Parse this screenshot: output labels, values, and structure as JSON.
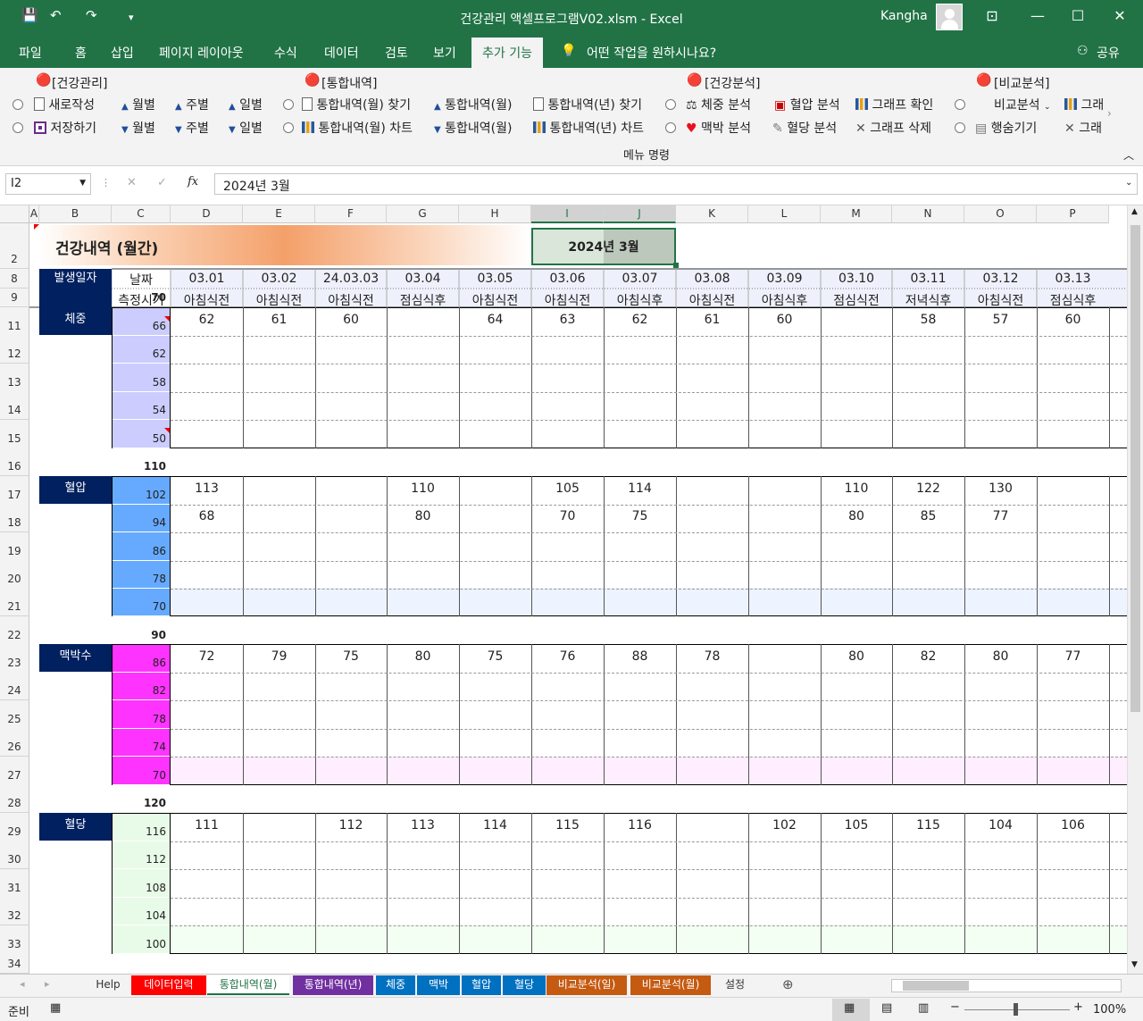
{
  "titlebar": {
    "title": "건강관리 액셀프로그램V02.xlsm  -  Excel",
    "user": "Kangha"
  },
  "menu": {
    "tabs": [
      "파일",
      "홈",
      "삽입",
      "페이지 레이아웃",
      "수식",
      "데이터",
      "검토",
      "보기",
      "추가 기능"
    ],
    "active_tab": "추가 기능",
    "search": "어떤 작업을 원하시나요?",
    "share": "공유"
  },
  "ribbon": {
    "groups": [
      "[건강관리]",
      "[통합내역]",
      "[건강분석]",
      "[비교분석]"
    ],
    "new": "새로작성",
    "save": "저장하기",
    "month": "월별",
    "week": "주별",
    "day": "일별",
    "find_month": "통합내역(월) 찾기",
    "chart_month": "통합내역(월) 차트",
    "integ_month": "통합내역(월)",
    "find_year": "통합내역(년) 찾기",
    "chart_year": "통합내역(년) 차트",
    "weight_analysis": "체중 분석",
    "pulse_analysis": "맥박 분석",
    "bp_analysis": "혈압 분석",
    "sugar_analysis": "혈당 분석",
    "graph_check": "그래프 확인",
    "graph_delete": "그래프 삭제",
    "compare": "비교분석",
    "hide_rows": "행숨기기",
    "graph_cut": "그래",
    "delete_cut": "그래",
    "group_label": "메뉴 명령"
  },
  "formula_bar": {
    "name_box": "I2",
    "formula": "2024년 3월"
  },
  "columns": [
    "A",
    "B",
    "C",
    "D",
    "E",
    "F",
    "G",
    "H",
    "I",
    "J",
    "K",
    "L",
    "M",
    "N",
    "O",
    "P"
  ],
  "rows": [
    "2",
    "8",
    "9",
    "11",
    "12",
    "13",
    "14",
    "15",
    "16",
    "17",
    "18",
    "19",
    "20",
    "21",
    "22",
    "23",
    "24",
    "25",
    "26",
    "27",
    "28",
    "29",
    "30",
    "31",
    "32",
    "33",
    "34"
  ],
  "sheet": {
    "title": "건강내역 (월간)",
    "month": "2024년 3월",
    "row_date_label": "발생일자",
    "date_label": "날짜",
    "time_label": "측정시기",
    "dates": [
      "03.01",
      "03.02",
      "24.03.03",
      "03.04",
      "03.05",
      "03.06",
      "03.07",
      "03.08",
      "03.09",
      "03.10",
      "03.11",
      "03.12",
      "03.13"
    ],
    "times": [
      "아침식전",
      "아침식전",
      "아침식전",
      "점심식후",
      "아침식전",
      "아침식전",
      "아침식후",
      "아침식전",
      "아침식후",
      "점심식전",
      "저녁식후",
      "아침식전",
      "점심식후"
    ],
    "sections": [
      {
        "label": "체중",
        "color": "#ccccff",
        "top": "70",
        "ticks": [
          "66",
          "62",
          "58",
          "54",
          "50"
        ],
        "values": [
          [
            "62",
            "61",
            "60",
            "",
            "64",
            "63",
            "62",
            "61",
            "60",
            "",
            "58",
            "57",
            "60"
          ]
        ]
      },
      {
        "label": "혈압",
        "color": "#66aaff",
        "top": "110",
        "ticks": [
          "102",
          "94",
          "86",
          "78",
          "70"
        ],
        "values": [
          [
            "113",
            "",
            "",
            "110",
            "",
            "105",
            "114",
            "",
            "",
            "110",
            "122",
            "130",
            ""
          ],
          [
            "68",
            "",
            "",
            "80",
            "",
            "70",
            "75",
            "",
            "",
            "80",
            "85",
            "77",
            ""
          ]
        ]
      },
      {
        "label": "맥박수",
        "color": "#ff33ff",
        "top": "90",
        "ticks": [
          "86",
          "82",
          "78",
          "74",
          "70"
        ],
        "values": [
          [
            "72",
            "79",
            "75",
            "80",
            "75",
            "76",
            "88",
            "78",
            "",
            "80",
            "82",
            "80",
            "77"
          ]
        ]
      },
      {
        "label": "혈당",
        "color": "#e8fbe8",
        "top": "120",
        "ticks": [
          "116",
          "112",
          "108",
          "104",
          "100"
        ],
        "values": [
          [
            "111",
            "",
            "112",
            "113",
            "114",
            "115",
            "116",
            "",
            "102",
            "105",
            "115",
            "104",
            "106"
          ]
        ]
      }
    ]
  },
  "sheet_tabs": [
    {
      "label": "Help",
      "color": ""
    },
    {
      "label": "데이터입력",
      "color": "#ff0000"
    },
    {
      "label": "통합내역(월)",
      "color": "active"
    },
    {
      "label": "통합내역(년)",
      "color": "#7030a0"
    },
    {
      "label": "체중",
      "color": "#0070c0"
    },
    {
      "label": "맥박",
      "color": "#0070c0"
    },
    {
      "label": "혈압",
      "color": "#0070c0"
    },
    {
      "label": "혈당",
      "color": "#0070c0"
    },
    {
      "label": "비교분석(일)",
      "color": "#c55a11"
    },
    {
      "label": "비교분석(월)",
      "color": "#c55a11"
    },
    {
      "label": "설정",
      "color": ""
    }
  ],
  "status": {
    "ready": "준비",
    "zoom": "100%"
  }
}
